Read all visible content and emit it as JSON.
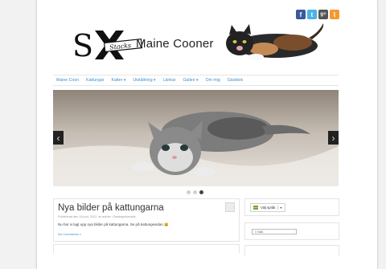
{
  "site": {
    "title": "Maine Cooner",
    "logo_text": "SX",
    "logo_script": "Stacks"
  },
  "social": [
    {
      "icon": "facebook-icon",
      "glyph": "f",
      "color": "#3b5998"
    },
    {
      "icon": "twitter-icon",
      "glyph": "t",
      "color": "#4ab3e6"
    },
    {
      "icon": "google-plus-icon",
      "glyph": "g+",
      "color": "#555555"
    },
    {
      "icon": "rss-icon",
      "glyph": "⌇",
      "color": "#f29a30"
    }
  ],
  "nav": [
    {
      "label": "Maine Coon"
    },
    {
      "label": "Kattungar"
    },
    {
      "label": "Katter ▾"
    },
    {
      "label": "Utställning ▾"
    },
    {
      "label": "Länkar"
    },
    {
      "label": "Galleri ▾"
    },
    {
      "label": "Om mig"
    },
    {
      "label": "Gästbok"
    }
  ],
  "slider": {
    "prev": "‹",
    "next": "›",
    "active_dot": 2
  },
  "post": {
    "title": "Nya bilder på kattungarna",
    "meta": "Publicerad den 18 juni, 2012, av admin i Okategoriserade.",
    "body": "Nu har vi lagt upp nya bilder på kattungarna. Se på kattungesidan 😀",
    "comments": "No Comments »"
  },
  "sidebar": {
    "language_button": "Välj språk",
    "language_arrow": "▾",
    "search_placeholder": "Sök"
  },
  "colors": {
    "link": "#3b8fd0",
    "accent_dark": "#222222"
  }
}
